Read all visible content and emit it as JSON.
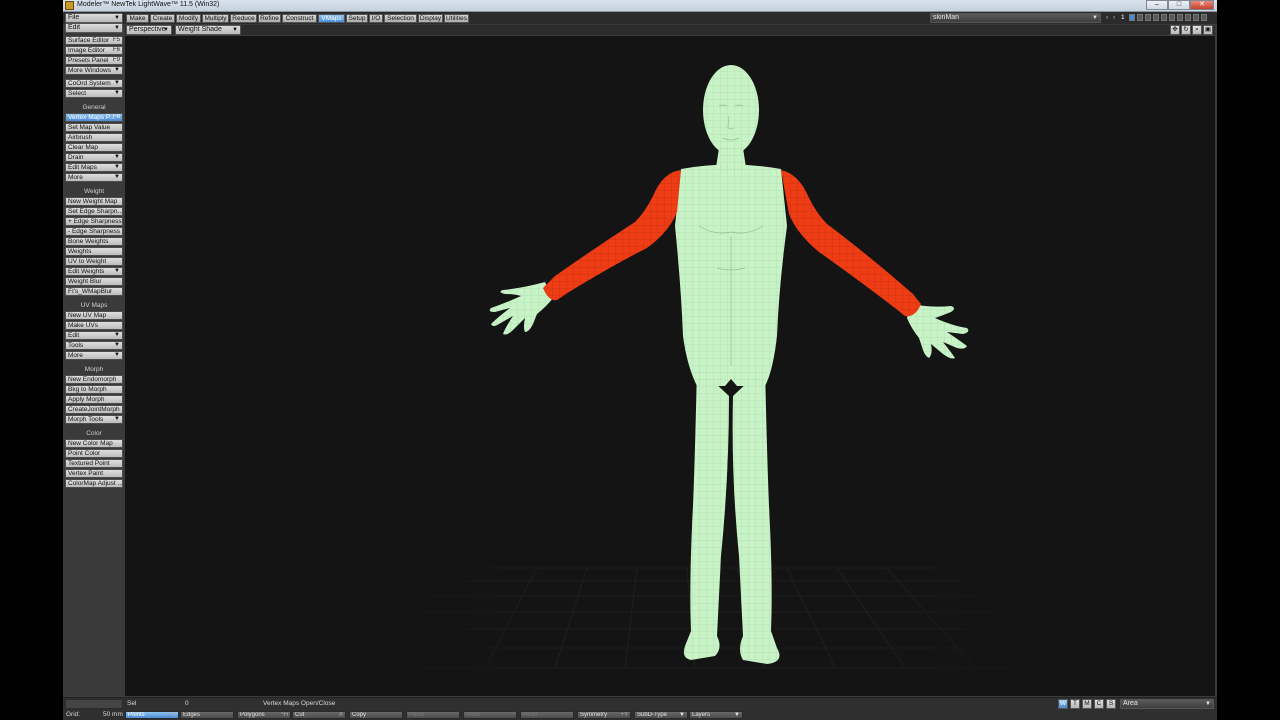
{
  "window": {
    "title": "Modeler™ NewTek LightWave™ 11.5 (Win32)",
    "controls": [
      "–",
      "□",
      "✕"
    ]
  },
  "top_left": {
    "file": "File",
    "edit": "Edit"
  },
  "tabs": [
    "Make",
    "Create",
    "Modify",
    "Multiply",
    "Reduce",
    "Refine",
    "Construct",
    "VMaps",
    "Setup",
    "I/O",
    "Selection",
    "Display",
    "Utilities"
  ],
  "active_tab": "VMaps",
  "object_select": "skinMan",
  "layer_readout": "1",
  "viewport": {
    "projection": "Perspective",
    "shading": "Weight Shade"
  },
  "sidebar": {
    "top_buttons": [
      {
        "label": "Surface Editor",
        "key": "F5"
      },
      {
        "label": "Image Editor",
        "key": "F6"
      },
      {
        "label": "Presets Panel",
        "key": "F9"
      },
      {
        "label": "More Windows",
        "key": ""
      },
      {
        "label": "CoOrd System",
        "key": ""
      },
      {
        "label": "Select",
        "key": ""
      }
    ],
    "general_label": "General",
    "general": [
      {
        "label": "Vertex Maps P...",
        "key": "F8"
      },
      {
        "label": "Set Map Value",
        "key": ""
      },
      {
        "label": "Airbrush",
        "key": ""
      },
      {
        "label": "Clear Map",
        "key": ""
      },
      {
        "label": "Drain",
        "key": ""
      },
      {
        "label": "Edit Maps",
        "key": ""
      },
      {
        "label": "More",
        "key": ""
      }
    ],
    "weight_label": "Weight",
    "weight": [
      "New Weight Map",
      "Set Edge Sharpn...",
      "+ Edge Sharpness",
      "- Edge Sharpness",
      "Bone Weights",
      "Weights",
      "UV to Weight",
      "Edit Weights",
      "Weight Blur",
      "FI's_WMapBlur"
    ],
    "uv_label": "UV Maps",
    "uv": [
      "New UV Map",
      "Make UVs",
      "Edit",
      "Tools",
      "More"
    ],
    "morph_label": "Morph",
    "morph": [
      "New Endomorph",
      "Bkg to Morph",
      "Apply Morph",
      "CreateJointMorph",
      "Morph Tools"
    ],
    "color_label": "Color",
    "color": [
      "New Color Map",
      "Point Color",
      "Textured Point",
      "Vertex Paint",
      "ColorMap Adjust ..."
    ]
  },
  "status": {
    "sel_label": "Sel",
    "sel_value": "0",
    "message": "Vertex Maps Open/Close",
    "grid_label": "Grid:",
    "grid_value": "50 mm",
    "modes": [
      {
        "label": "Points",
        "key": "^G"
      },
      {
        "label": "Edges",
        "key": ""
      },
      {
        "label": "Polygons",
        "key": "^H"
      },
      {
        "label": "Cut",
        "key": "X"
      },
      {
        "label": "Copy",
        "key": ""
      },
      {
        "label": "Paste",
        "key": ""
      },
      {
        "label": "Undo",
        "key": ""
      },
      {
        "label": "Redo",
        "key": ""
      },
      {
        "label": "Symmetry",
        "key": "+Y"
      },
      {
        "label": "SubD-Type",
        "key": ""
      },
      {
        "label": "Layers",
        "key": ""
      }
    ],
    "wtmcs": [
      "W",
      "T",
      "M",
      "C",
      "S"
    ],
    "area": "Area"
  },
  "colors": {
    "mesh_base": "#c8f3c6",
    "weight_high": "#ee3d14",
    "active_blue": "#4a8ad1",
    "viewport_bg": "#141414"
  }
}
